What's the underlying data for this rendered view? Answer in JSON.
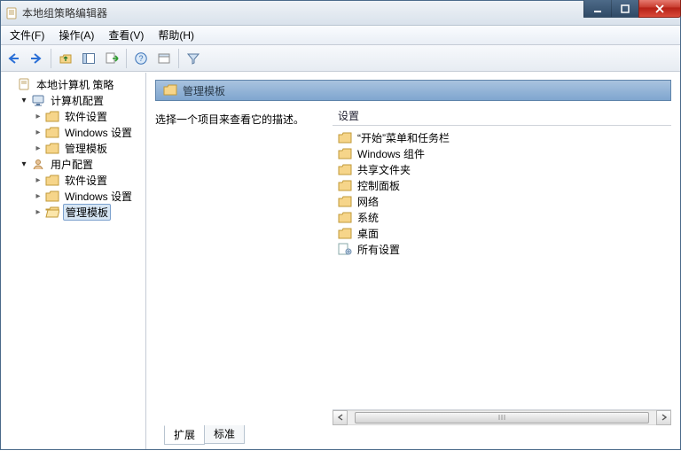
{
  "title": "本地组策略编辑器",
  "menu": {
    "file": "文件(F)",
    "action": "操作(A)",
    "view": "查看(V)",
    "help": "帮助(H)"
  },
  "tree": {
    "root": "本地计算机 策略",
    "computer": "计算机配置",
    "computer_children": [
      "软件设置",
      "Windows 设置",
      "管理模板"
    ],
    "user": "用户配置",
    "user_children": [
      "软件设置",
      "Windows 设置",
      "管理模板"
    ]
  },
  "heading": "管理模板",
  "description_prompt": "选择一个项目来查看它的描述。",
  "column_header": "设置",
  "items": [
    "“开始”菜单和任务栏",
    "Windows 组件",
    "共享文件夹",
    "控制面板",
    "网络",
    "系统",
    "桌面",
    "所有设置"
  ],
  "tabs": {
    "extended": "扩展",
    "standard": "标准"
  }
}
